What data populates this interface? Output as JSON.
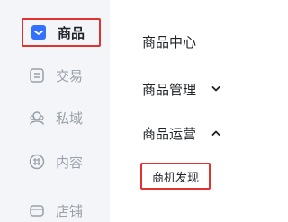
{
  "sidebar": {
    "items": [
      {
        "label": "商品",
        "icon": "product-icon",
        "active": true
      },
      {
        "label": "交易",
        "icon": "trade-icon",
        "active": false
      },
      {
        "label": "私域",
        "icon": "private-domain-icon",
        "active": false
      },
      {
        "label": "内容",
        "icon": "content-icon",
        "active": false
      },
      {
        "label": "店铺",
        "icon": "store-icon",
        "active": false
      }
    ]
  },
  "submenu": {
    "center": "商品中心",
    "manage": "商品管理",
    "operations": "商品运营",
    "opportunity": "商机发现"
  },
  "colors": {
    "highlight": "#e0322f",
    "active_icon": "#3370ff",
    "muted": "#9aa0aa",
    "sidebar_bg": "#f4f5f8"
  }
}
